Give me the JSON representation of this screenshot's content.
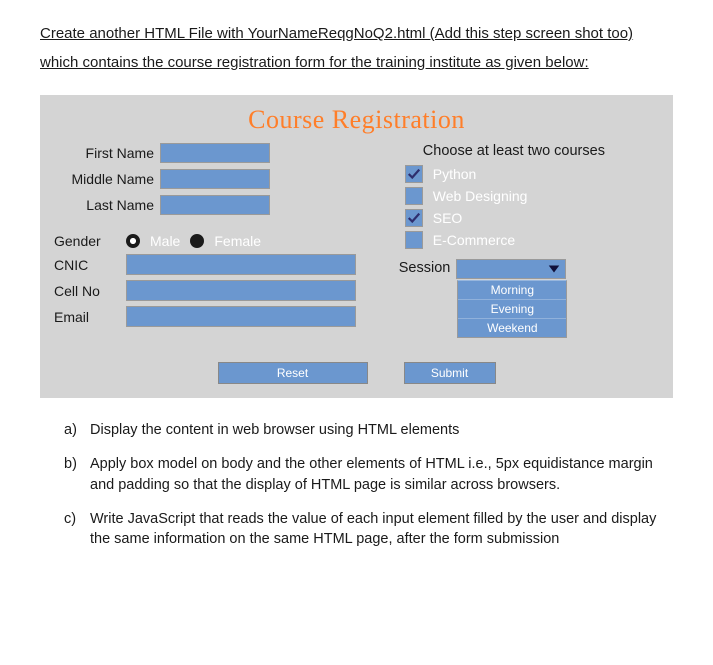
{
  "instruction": "Create another HTML File with YourNameReqgNoQ2.html (Add this step screen shot too) which contains  the course registration form for the training institute as given below:",
  "form": {
    "title": "Course Registration",
    "labels": {
      "first_name": "First Name",
      "middle_name": "Middle Name",
      "last_name": "Last Name",
      "gender": "Gender",
      "cnic": "CNIC",
      "cell_no": "Cell No",
      "email": "Email",
      "session": "Session"
    },
    "gender_options": {
      "male": "Male",
      "female": "Female"
    },
    "courses_header": "Choose at least two courses",
    "courses": [
      {
        "label": "Python",
        "checked": true
      },
      {
        "label": "Web Designing",
        "checked": false
      },
      {
        "label": "SEO",
        "checked": true
      },
      {
        "label": "E-Commerce",
        "checked": false
      }
    ],
    "session_options": [
      "Morning",
      "Evening",
      "Weekend"
    ],
    "buttons": {
      "reset": "Reset",
      "submit": "Submit"
    }
  },
  "questions": [
    {
      "letter": "a)",
      "text": "Display the content in web browser using HTML elements"
    },
    {
      "letter": "b)",
      "text": "Apply box model on body and the other elements of HTML i.e., 5px equidistance margin and padding so that the display of HTML page is similar across browsers."
    },
    {
      "letter": "c)",
      "text": "Write JavaScript that reads the value of each input element filled by the user and display the same information on the same HTML page, after the form submission"
    }
  ]
}
